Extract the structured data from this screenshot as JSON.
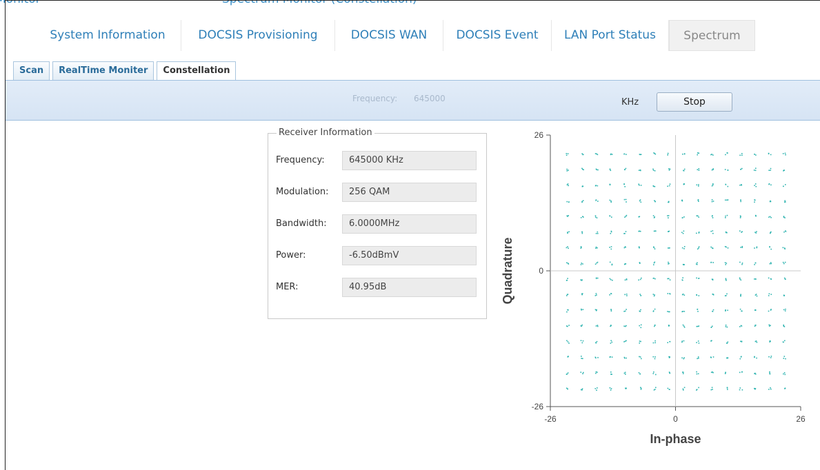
{
  "browser": {
    "strip_left_text": "Monitor",
    "strip_right_text": "Spectrum Monitor (Constellation)"
  },
  "main_tabs": [
    {
      "label": "System Information",
      "active": false
    },
    {
      "label": "DOCSIS Provisioning",
      "active": false
    },
    {
      "label": "DOCSIS WAN",
      "active": false
    },
    {
      "label": "DOCSIS Event",
      "active": false
    },
    {
      "label": "LAN Port Status",
      "active": false
    },
    {
      "label": "Spectrum",
      "active": true
    }
  ],
  "sub_tabs": [
    {
      "label": "Scan",
      "active": false
    },
    {
      "label": "RealTime Moniter",
      "active": false
    },
    {
      "label": "Constellation",
      "active": true
    }
  ],
  "frequency_bar": {
    "label": "Frequency:",
    "value": "645000",
    "unit": "KHz",
    "button_label": "Stop"
  },
  "receiver": {
    "legend": "Receiver Information",
    "rows": [
      {
        "label": "Frequency:",
        "value": "645000 KHz"
      },
      {
        "label": "Modulation:",
        "value": "256 QAM"
      },
      {
        "label": "Bandwidth:",
        "value": "6.0000MHz"
      },
      {
        "label": "Power:",
        "value": "-6.50dBmV"
      },
      {
        "label": "MER:",
        "value": "40.95dB"
      }
    ]
  },
  "colors": {
    "tab_text": "#2e7fb8",
    "point_color": "#2fb4b0",
    "bar_bg": "#d9e6f5"
  },
  "chart_data": {
    "type": "scatter",
    "title": "",
    "xlabel": "In-phase",
    "ylabel": "Quadrature",
    "xlim": [
      -26,
      26
    ],
    "ylim": [
      -26,
      26
    ],
    "x_ticks": [
      "-26",
      "0",
      "26"
    ],
    "y_ticks": [
      "26",
      "0",
      "-26"
    ],
    "grid": false,
    "series": [
      {
        "label": "constellation",
        "pattern": "16x16 grid of symbol points at ±1.5 … ±22.5 spacing 3, both axes"
      }
    ]
  }
}
